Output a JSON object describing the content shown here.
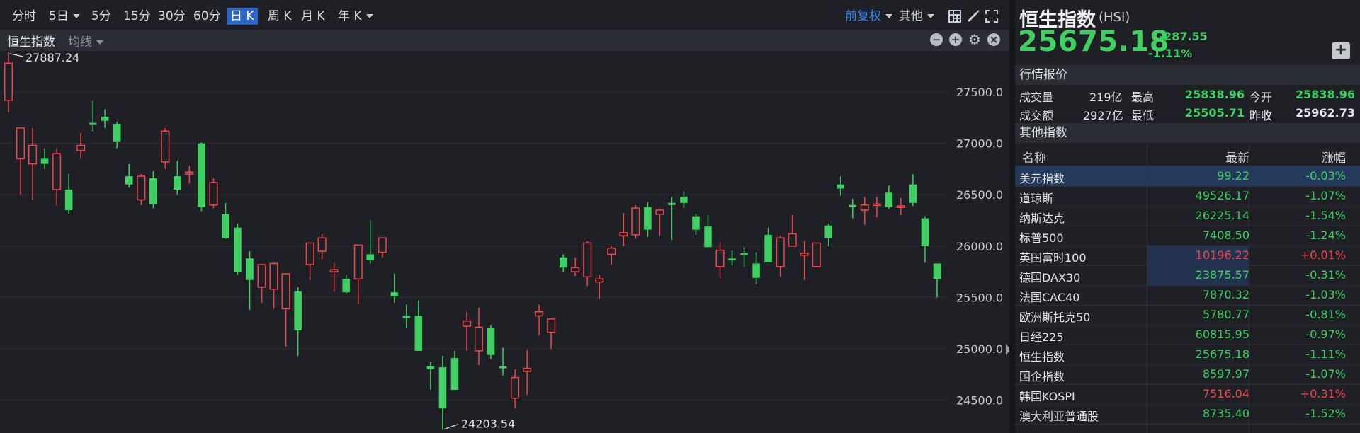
{
  "toolbar": {
    "periods": [
      "分时",
      "5日",
      "5分",
      "15分",
      "30分",
      "60分",
      "日 K",
      "周 K",
      "月 K",
      "年 K"
    ],
    "active": "日 K",
    "adjust": "前复权",
    "more": "其他"
  },
  "subbar": {
    "title": "恒生指数",
    "ma": "均线"
  },
  "header": {
    "name": "恒生指数",
    "code": "(HSI)",
    "price": "25675.18",
    "change": "-287.55",
    "change_pct": "-1.11%"
  },
  "quote": {
    "section": "行情报价",
    "volume_label": "成交量",
    "volume": "219亿",
    "high_label": "最高",
    "high": "25838.96",
    "open_label": "今开",
    "open": "25838.96",
    "amount_label": "成交额",
    "amount": "2927亿",
    "low_label": "最低",
    "low": "25505.71",
    "prev_label": "昨收",
    "prev": "25962.73"
  },
  "others": {
    "section": "其他指数",
    "col_name": "名称",
    "col_last": "最新",
    "col_chg": "涨幅",
    "rows": [
      {
        "name": "美元指数",
        "last": "99.22",
        "chg": "-0.03%",
        "dir": "down"
      },
      {
        "name": "道琼斯",
        "last": "49526.17",
        "chg": "-1.07%",
        "dir": "down"
      },
      {
        "name": "纳斯达克",
        "last": "26225.14",
        "chg": "-1.54%",
        "dir": "down"
      },
      {
        "name": "标普500",
        "last": "7408.50",
        "chg": "-1.24%",
        "dir": "down"
      },
      {
        "name": "英国富时100",
        "last": "10196.22",
        "chg": "+0.01%",
        "dir": "up"
      },
      {
        "name": "德国DAX30",
        "last": "23875.57",
        "chg": "-0.31%",
        "dir": "down"
      },
      {
        "name": "法国CAC40",
        "last": "7870.32",
        "chg": "-1.03%",
        "dir": "down"
      },
      {
        "name": "欧洲斯托克50",
        "last": "5780.77",
        "chg": "-0.81%",
        "dir": "down"
      },
      {
        "name": "日经225",
        "last": "60815.95",
        "chg": "-0.97%",
        "dir": "down"
      },
      {
        "name": "恒生指数",
        "last": "25675.18",
        "chg": "-1.11%",
        "dir": "down"
      },
      {
        "name": "国企指数",
        "last": "8597.97",
        "chg": "-1.07%",
        "dir": "down"
      },
      {
        "name": "韩国KOSPI",
        "last": "7516.04",
        "chg": "+0.31%",
        "dir": "up"
      },
      {
        "name": "澳大利亚普通股",
        "last": "8735.40",
        "chg": "-1.52%",
        "dir": "down"
      }
    ]
  },
  "chart_data": {
    "type": "candlestick",
    "y_ticks": [
      "27500.0",
      "27000.0",
      "26500.0",
      "26000.0",
      "25500.0",
      "25000.0",
      "24500.0"
    ],
    "ylim": [
      24180,
      27900
    ],
    "max_label": "27887.24",
    "min_label": "24203.54",
    "candles": [
      [
        27420,
        27887,
        27300,
        27780
      ],
      [
        26850,
        27100,
        26500,
        27150
      ],
      [
        26800,
        27150,
        26450,
        26980
      ],
      [
        26850,
        26950,
        26750,
        26800
      ],
      [
        26550,
        26950,
        26400,
        26900
      ],
      [
        26550,
        26700,
        26310,
        26350
      ],
      [
        26930,
        27100,
        26850,
        26980
      ],
      [
        27200,
        27410,
        27120,
        27190
      ],
      [
        27260,
        27330,
        27150,
        27220
      ],
      [
        27190,
        27210,
        26950,
        27020
      ],
      [
        26680,
        26800,
        26570,
        26600
      ],
      [
        26450,
        26700,
        26400,
        26680
      ],
      [
        26660,
        26730,
        26370,
        26410
      ],
      [
        26820,
        27150,
        26750,
        27120
      ],
      [
        26680,
        26830,
        26500,
        26550
      ],
      [
        26700,
        26780,
        26610,
        26720
      ],
      [
        27000,
        27010,
        26340,
        26380
      ],
      [
        26400,
        26660,
        26370,
        26620
      ],
      [
        26310,
        26420,
        26070,
        26080
      ],
      [
        26180,
        26220,
        25720,
        25750
      ],
      [
        25880,
        25950,
        25380,
        25670
      ],
      [
        25600,
        25740,
        25450,
        25820
      ],
      [
        25580,
        25840,
        25390,
        25830
      ],
      [
        25390,
        25630,
        25020,
        25730
      ],
      [
        25560,
        25600,
        24930,
        25180
      ],
      [
        25820,
        26010,
        25670,
        26030
      ],
      [
        25950,
        26120,
        25870,
        26080
      ],
      [
        25750,
        25840,
        25550,
        25770
      ],
      [
        25680,
        25720,
        25540,
        25550
      ],
      [
        25680,
        26010,
        25440,
        26010
      ],
      [
        25920,
        26250,
        25830,
        25860
      ],
      [
        25940,
        26040,
        25890,
        26080
      ],
      [
        25550,
        25730,
        25450,
        25510
      ],
      [
        25320,
        25430,
        25200,
        25300
      ],
      [
        25320,
        25470,
        25050,
        24980
      ],
      [
        24830,
        24870,
        24600,
        24800
      ],
      [
        24820,
        24930,
        24210,
        24420
      ],
      [
        24910,
        24980,
        24880,
        24600
      ],
      [
        25220,
        25360,
        24980,
        25270
      ],
      [
        24980,
        25400,
        24840,
        25210
      ],
      [
        25200,
        25230,
        24900,
        24940
      ],
      [
        24830,
        25010,
        24740,
        24810
      ],
      [
        24520,
        24800,
        24420,
        24720
      ],
      [
        24780,
        24990,
        24550,
        24810
      ],
      [
        25320,
        25430,
        25130,
        25360
      ],
      [
        25160,
        25250,
        25000,
        25290
      ],
      [
        25890,
        25920,
        25750,
        25790
      ],
      [
        25750,
        25890,
        25710,
        25790
      ],
      [
        25700,
        26050,
        25610,
        26030
      ],
      [
        25650,
        25720,
        25490,
        25680
      ],
      [
        25920,
        26000,
        25820,
        25980
      ],
      [
        26100,
        26320,
        26000,
        26130
      ],
      [
        26110,
        26400,
        26070,
        26370
      ],
      [
        26380,
        26430,
        26090,
        26160
      ],
      [
        26310,
        26360,
        26100,
        26350
      ],
      [
        26420,
        26480,
        26060,
        26400
      ],
      [
        26480,
        26530,
        26370,
        26420
      ],
      [
        26290,
        26310,
        26110,
        26160
      ],
      [
        26190,
        26300,
        26080,
        25990
      ],
      [
        25800,
        26040,
        25690,
        25960
      ],
      [
        25880,
        25960,
        25810,
        25860
      ],
      [
        25930,
        25990,
        25800,
        25920
      ],
      [
        25830,
        25940,
        25630,
        25690
      ],
      [
        26110,
        26180,
        26000,
        25840
      ],
      [
        25800,
        26100,
        25700,
        26080
      ],
      [
        26000,
        26300,
        26100,
        26120
      ],
      [
        25910,
        26050,
        25670,
        25930
      ],
      [
        25800,
        26000,
        25810,
        26030
      ],
      [
        26200,
        26220,
        26000,
        26080
      ],
      [
        26600,
        26680,
        26490,
        26560
      ],
      [
        26400,
        26460,
        26270,
        26380
      ],
      [
        26350,
        26480,
        26210,
        26400
      ],
      [
        26400,
        26480,
        26280,
        26410
      ],
      [
        26520,
        26590,
        26360,
        26380
      ],
      [
        26380,
        26470,
        26300,
        26390
      ],
      [
        26600,
        26700,
        26390,
        26420
      ],
      [
        26270,
        26290,
        25840,
        26000
      ],
      [
        25830,
        25830,
        25500,
        25680
      ]
    ]
  }
}
